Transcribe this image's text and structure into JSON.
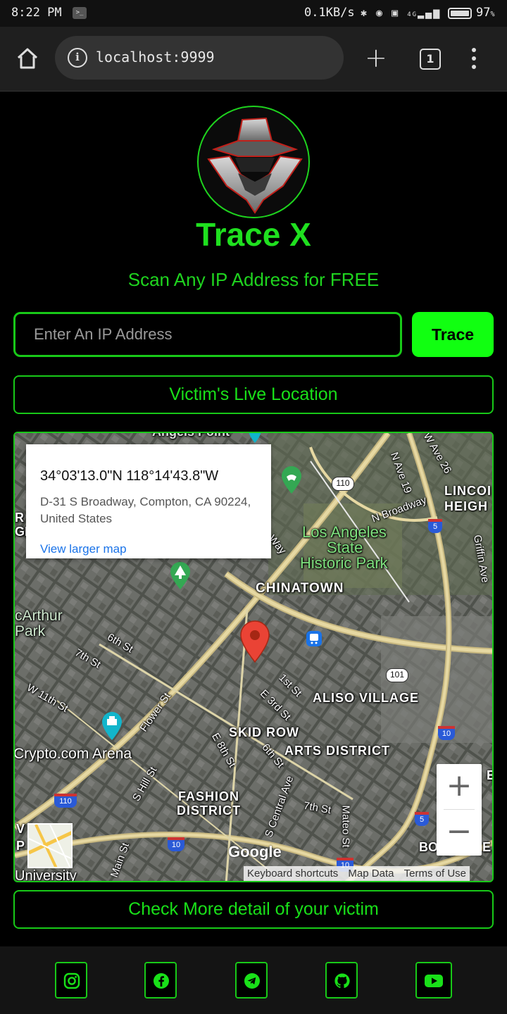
{
  "status_bar": {
    "time": "8:22 PM",
    "net_speed": "0.1KB/s",
    "network": "4G",
    "battery": "97",
    "battery_unit": "%"
  },
  "browser": {
    "url": "localhost:9999",
    "tab_count": "1"
  },
  "app": {
    "title": "Trace X",
    "subtitle": "Scan Any IP Address for FREE",
    "ip_placeholder": "Enter An IP Address",
    "trace_label": "Trace",
    "live_location_label": "Victim's Live Location",
    "more_detail_label": "Check More detail of your victim"
  },
  "map": {
    "info": {
      "coords": "34°03'13.0\"N 118°14'43.8\"W",
      "address": "D-31 S Broadway, Compton, CA 90224, United States",
      "larger_map": "View larger map"
    },
    "labels": {
      "chinatown": "CHINATOWN",
      "la_state_park": [
        "Los Angeles",
        "State",
        "Historic Park"
      ],
      "aliso_village": "ALISO VILLAGE",
      "skid_row": "SKID ROW",
      "arts_district": "ARTS DISTRICT",
      "fashion_district": [
        "FASHION",
        "DISTRICT"
      ],
      "crypto_arena": "Crypto.com Arena",
      "macarthur_park": [
        "cArthur",
        "Park"
      ],
      "lincoln_heights": [
        "LINCOI",
        "HEIGH"
      ],
      "university": "University",
      "angels_point": "Angels Point",
      "streets": [
        "6th St",
        "7th St",
        "W 11th St",
        "Flower St",
        "S Hill St",
        "E 8th St",
        "6th St",
        "E 3rd St",
        "1st St",
        "S Central Ave",
        "7th St",
        "Mateo St",
        "Main St",
        "N Broadway",
        "N Ave 19",
        "W Ave 26",
        "Griffin Ave",
        "Way"
      ],
      "shields": [
        "110",
        "5",
        "101",
        "10",
        "110",
        "10",
        "5",
        "10"
      ],
      "edge_letters": [
        "R",
        "GE",
        "V",
        "P",
        "BO",
        "E",
        "E"
      ],
      "google": "Google"
    },
    "zoom_in": "+",
    "zoom_out": "−",
    "attribution": [
      "Keyboard shortcuts",
      "Map Data",
      "Terms of Use"
    ]
  },
  "footer": {
    "social": [
      "instagram",
      "facebook",
      "telegram",
      "github",
      "youtube"
    ]
  }
}
